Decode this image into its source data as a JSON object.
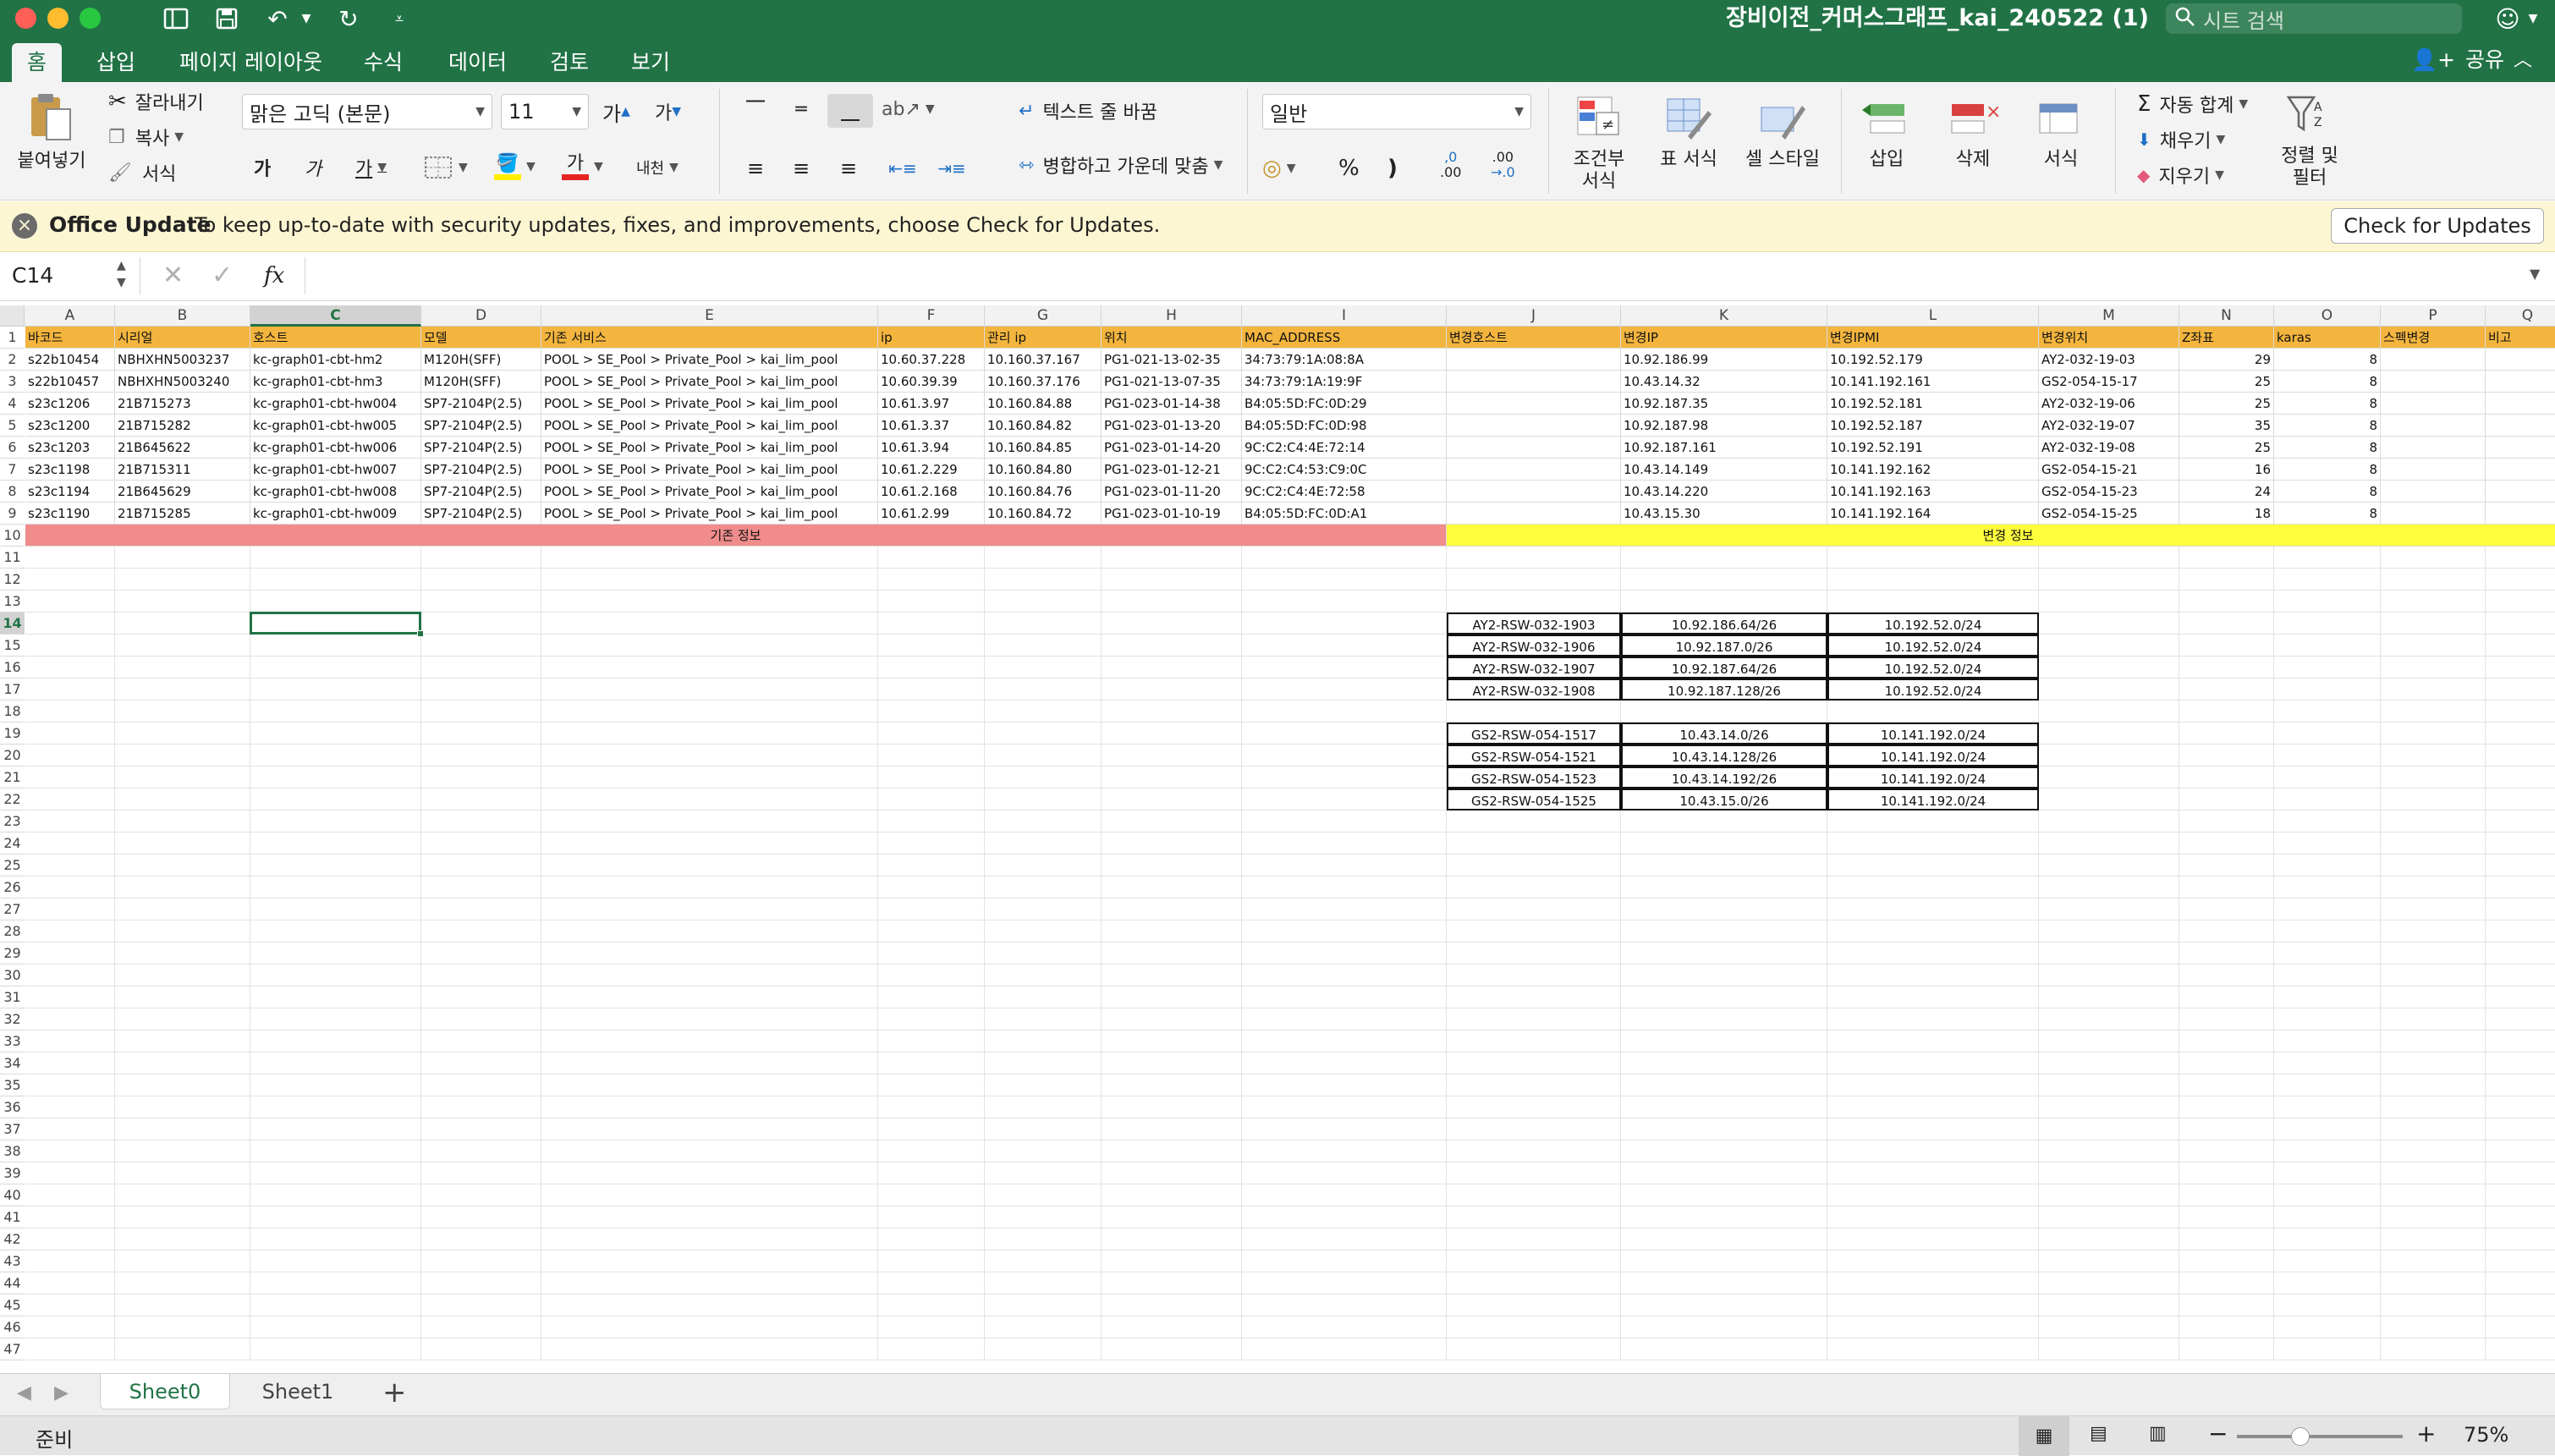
{
  "window": {
    "title": "장비이전_커머스그래프_kai_240522 (1)",
    "search_placeholder": "시트 검색"
  },
  "tabs": [
    "홈",
    "삽입",
    "페이지 레이아웃",
    "수식",
    "데이터",
    "검토",
    "보기"
  ],
  "share_label": "공유",
  "ribbon": {
    "paste": "붙여넣기",
    "cut": "잘라내기",
    "copy": "복사",
    "format_painter": "서식",
    "font_name": "맑은 고딕 (본문)",
    "font_size": "11",
    "grow_font": "가",
    "shrink_font": "가",
    "bold": "가",
    "italic": "가",
    "underline": "가",
    "font_color_glyph": "가",
    "phonetic": "내천",
    "wrap_text": "텍스트 줄 바꿈",
    "merge_center": "병합하고 가운데 맞춤",
    "number_format": "일반",
    "percent": "%",
    "comma": ")",
    "inc_decimal_top": ",0",
    "inc_decimal_bottom": ".00",
    "dec_decimal_top": ".00",
    "dec_decimal_bottom": "→.0",
    "conditional_format": "조건부\n서식",
    "format_as_table": "표 서식",
    "cell_styles": "셀 스타일",
    "insert": "삽입",
    "delete": "삭제",
    "format": "서식",
    "autosum": "자동 합계",
    "fill": "채우기",
    "clear": "지우기",
    "sort_filter": "정렬 및\n필터"
  },
  "update_bar": {
    "title": "Office Update",
    "message": "To keep up-to-date with security updates, fixes, and improvements, choose Check for Updates.",
    "button": "Check for Updates"
  },
  "formula_bar": {
    "name_box": "C14",
    "fx": "fx",
    "value": ""
  },
  "columns": [
    "A",
    "B",
    "C",
    "D",
    "E",
    "F",
    "G",
    "H",
    "I",
    "J",
    "K",
    "L",
    "M",
    "N",
    "O",
    "P",
    "Q"
  ],
  "selected_column": "C",
  "selected_row": 14,
  "row_count": 47,
  "header_row": [
    "바코드",
    "시리얼",
    "호스트",
    "모델",
    "기존 서비스",
    "ip",
    "관리 ip",
    "위치",
    "MAC_ADDRESS",
    "변경호스트",
    "변경IP",
    "변경IPMI",
    "변경위치",
    "Z좌표",
    "karas",
    "스펙변경",
    "비고"
  ],
  "data_rows": [
    [
      "s22b10454",
      "NBHXHN5003237",
      "kc-graph01-cbt-hm2",
      "M120H(SFF)",
      "POOL > SE_Pool > Private_Pool > kai_lim_pool",
      "10.60.37.228",
      "10.160.37.167",
      "PG1-021-13-02-35",
      "34:73:79:1A:08:8A",
      "",
      "10.92.186.99",
      "10.192.52.179",
      "AY2-032-19-03",
      "29",
      "8",
      "",
      ""
    ],
    [
      "s22b10457",
      "NBHXHN5003240",
      "kc-graph01-cbt-hm3",
      "M120H(SFF)",
      "POOL > SE_Pool > Private_Pool > kai_lim_pool",
      "10.60.39.39",
      "10.160.37.176",
      "PG1-021-13-07-35",
      "34:73:79:1A:19:9F",
      "",
      "10.43.14.32",
      "10.141.192.161",
      "GS2-054-15-17",
      "25",
      "8",
      "",
      ""
    ],
    [
      "s23c1206",
      "21B715273",
      "kc-graph01-cbt-hw004",
      "SP7-2104P(2.5)",
      "POOL > SE_Pool > Private_Pool > kai_lim_pool",
      "10.61.3.97",
      "10.160.84.88",
      "PG1-023-01-14-38",
      "B4:05:5D:FC:0D:29",
      "",
      "10.92.187.35",
      "10.192.52.181",
      "AY2-032-19-06",
      "25",
      "8",
      "",
      ""
    ],
    [
      "s23c1200",
      "21B715282",
      "kc-graph01-cbt-hw005",
      "SP7-2104P(2.5)",
      "POOL > SE_Pool > Private_Pool > kai_lim_pool",
      "10.61.3.37",
      "10.160.84.82",
      "PG1-023-01-13-20",
      "B4:05:5D:FC:0D:98",
      "",
      "10.92.187.98",
      "10.192.52.187",
      "AY2-032-19-07",
      "35",
      "8",
      "",
      ""
    ],
    [
      "s23c1203",
      "21B645622",
      "kc-graph01-cbt-hw006",
      "SP7-2104P(2.5)",
      "POOL > SE_Pool > Private_Pool > kai_lim_pool",
      "10.61.3.94",
      "10.160.84.85",
      "PG1-023-01-14-20",
      "9C:C2:C4:4E:72:14",
      "",
      "10.92.187.161",
      "10.192.52.191",
      "AY2-032-19-08",
      "25",
      "8",
      "",
      ""
    ],
    [
      "s23c1198",
      "21B715311",
      "kc-graph01-cbt-hw007",
      "SP7-2104P(2.5)",
      "POOL > SE_Pool > Private_Pool > kai_lim_pool",
      "10.61.2.229",
      "10.160.84.80",
      "PG1-023-01-12-21",
      "9C:C2:C4:53:C9:0C",
      "",
      "10.43.14.149",
      "10.141.192.162",
      "GS2-054-15-21",
      "16",
      "8",
      "",
      ""
    ],
    [
      "s23c1194",
      "21B645629",
      "kc-graph01-cbt-hw008",
      "SP7-2104P(2.5)",
      "POOL > SE_Pool > Private_Pool > kai_lim_pool",
      "10.61.2.168",
      "10.160.84.76",
      "PG1-023-01-11-20",
      "9C:C2:C4:4E:72:58",
      "",
      "10.43.14.220",
      "10.141.192.163",
      "GS2-054-15-23",
      "24",
      "8",
      "",
      ""
    ],
    [
      "s23c1190",
      "21B715285",
      "kc-graph01-cbt-hw009",
      "SP7-2104P(2.5)",
      "POOL > SE_Pool > Private_Pool > kai_lim_pool",
      "10.61.2.99",
      "10.160.84.72",
      "PG1-023-01-10-19",
      "B4:05:5D:FC:0D:A1",
      "",
      "10.43.15.30",
      "10.141.192.164",
      "GS2-054-15-25",
      "18",
      "8",
      "",
      ""
    ]
  ],
  "band_labels": {
    "existing": "기존 정보",
    "changed": "변경 정보"
  },
  "band_colors": {
    "existing": "#f08c8c",
    "changed": "#ffff3c",
    "header": "#f3b53e"
  },
  "switch_table_1": [
    [
      "AY2-RSW-032-1903",
      "10.92.186.64/26",
      "10.192.52.0/24"
    ],
    [
      "AY2-RSW-032-1906",
      "10.92.187.0/26",
      "10.192.52.0/24"
    ],
    [
      "AY2-RSW-032-1907",
      "10.92.187.64/26",
      "10.192.52.0/24"
    ],
    [
      "AY2-RSW-032-1908",
      "10.92.187.128/26",
      "10.192.52.0/24"
    ]
  ],
  "switch_table_2": [
    [
      "GS2-RSW-054-1517",
      "10.43.14.0/26",
      "10.141.192.0/24"
    ],
    [
      "GS2-RSW-054-1521",
      "10.43.14.128/26",
      "10.141.192.0/24"
    ],
    [
      "GS2-RSW-054-1523",
      "10.43.14.192/26",
      "10.141.192.0/24"
    ],
    [
      "GS2-RSW-054-1525",
      "10.43.15.0/26",
      "10.141.192.0/24"
    ]
  ],
  "sheets": [
    "Sheet0",
    "Sheet1"
  ],
  "active_sheet": "Sheet0",
  "status": {
    "ready": "준비",
    "zoom": "75%"
  },
  "accent": "#217346"
}
